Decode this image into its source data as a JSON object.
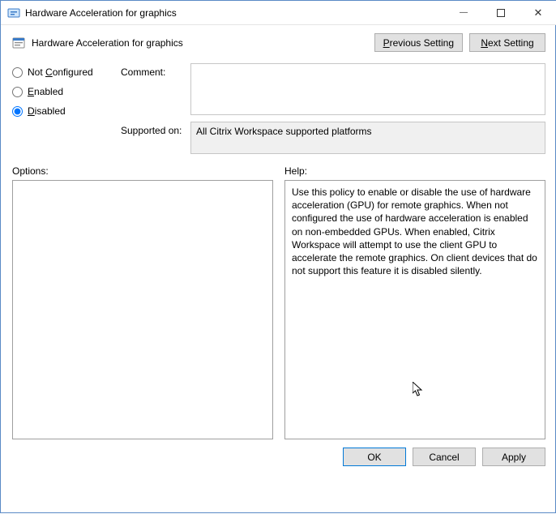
{
  "window": {
    "title": "Hardware Acceleration for graphics"
  },
  "header": {
    "title": "Hardware Acceleration for graphics",
    "previous_btn": {
      "prefix": "P",
      "rest": "revious Setting"
    },
    "next_btn": {
      "prefix": "N",
      "rest": "ext Setting"
    }
  },
  "radios": {
    "not_configured": {
      "prefix": "C",
      "rest_before": "Not ",
      "rest_after": "onfigured"
    },
    "enabled": {
      "prefix": "E",
      "rest": "nabled"
    },
    "disabled": {
      "prefix": "D",
      "rest": "isabled"
    },
    "selected": "disabled"
  },
  "fields": {
    "comment_label": "Comment:",
    "comment_value": "",
    "supported_label": "Supported on:",
    "supported_value": "All Citrix Workspace supported platforms"
  },
  "lower": {
    "options_label": "Options:",
    "help_label": "Help:",
    "options_text": "",
    "help_text": "Use this policy to enable or disable the use of hardware acceleration (GPU) for remote graphics. When not configured the use of hardware acceleration is enabled on non-embedded GPUs. When enabled, Citrix Workspace will attempt to use the client GPU to accelerate the remote graphics. On client devices that do not support this feature it is disabled silently."
  },
  "buttons": {
    "ok": "OK",
    "cancel": "Cancel",
    "apply": "Apply"
  }
}
